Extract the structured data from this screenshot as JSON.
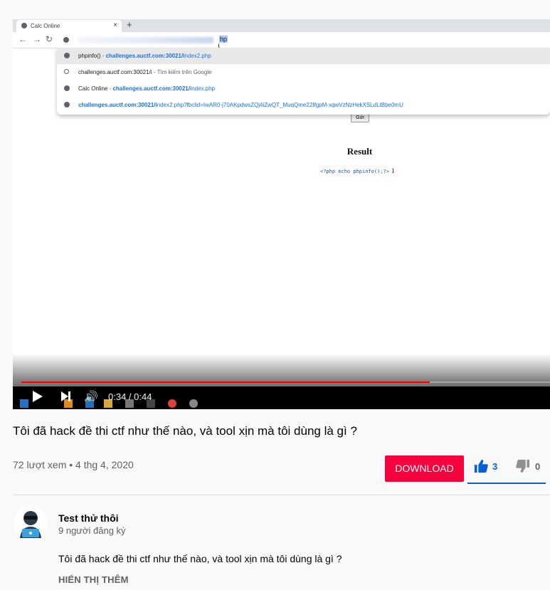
{
  "browser": {
    "tab_title": "Calc Online",
    "tab_close": "×",
    "new_tab": "+",
    "address_suffix": "hp",
    "suggestions": [
      {
        "prefix": "phpinfo()",
        "sep": " - ",
        "url_bold": "challenges.auctf.com:30021/i",
        "url_rest": "ndex2.php"
      },
      {
        "prefix": "challenges.auctf.com:30021/i",
        "sep": " - ",
        "url_bold": "",
        "url_rest": "Tìm kiếm trên Google"
      },
      {
        "prefix": "Calc Online",
        "sep": " - ",
        "url_bold": "challenges.auctf.com:30021/i",
        "url_rest": "ndex.php"
      },
      {
        "prefix": "",
        "sep": "",
        "url_bold": "challenges.auctf.com:30021/i",
        "url_rest": "ndex2.php?fbclid=IwAR0-j70AKpdwsZQj4iZwQT_MuqQme22IfgpM-xqwVzNzHekXSLdLtBbe0mU"
      }
    ]
  },
  "page": {
    "submit_button": "Gửi",
    "result_heading": "Result",
    "code_line": "<?php echo phpinfo();?>",
    "code_result": "1"
  },
  "player": {
    "time_current": "0:34",
    "time_total": "0:44",
    "time_display": "0:34 / 0:44",
    "progress_fraction": 0.773,
    "accent_color": "#ff0000"
  },
  "video": {
    "title": "Tôi đã hack đề thi ctf như thế nào, và tool xịn mà tôi dùng là gì ?",
    "meta": "72 lượt xem • 4 thg 4, 2020",
    "download_label": "DOWNLOAD",
    "likes": "3",
    "dislikes": "0"
  },
  "channel": {
    "name": "Test thử thôi",
    "subscribers": "9 người đăng ký",
    "description": "Tôi đã hack đề thi ctf như thế nào, và tool xịn mà tôi dùng là gì ?",
    "show_more": "HIỂN THỊ THÊM"
  },
  "colors": {
    "download_bg": "#f6003e",
    "like_active": "#065fd4"
  }
}
